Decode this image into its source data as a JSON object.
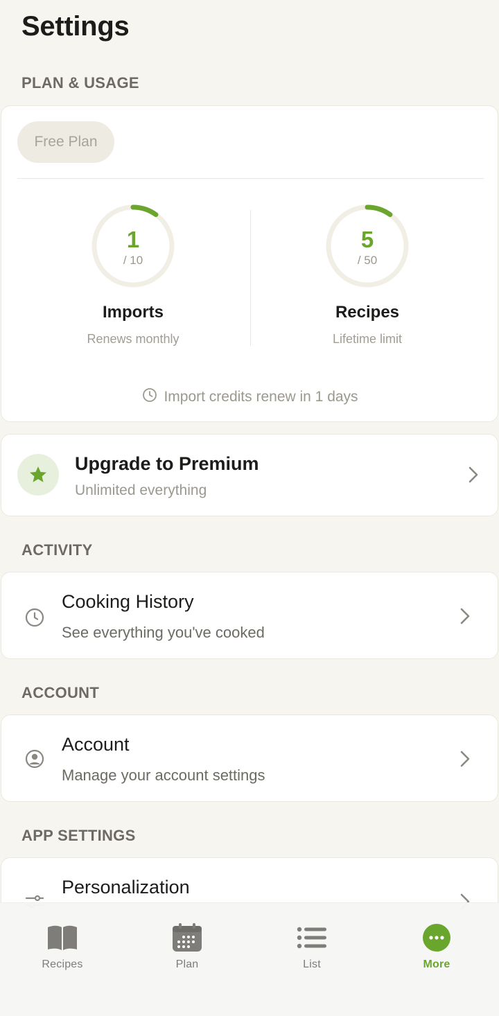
{
  "page": {
    "title": "Settings"
  },
  "sections": {
    "plan_usage": "PLAN & USAGE",
    "activity": "ACTIVITY",
    "account": "ACCOUNT",
    "app_settings": "APP SETTINGS"
  },
  "plan": {
    "chip": "Free Plan",
    "imports": {
      "value": "1",
      "limit": "/ 10",
      "label": "Imports",
      "sub": "Renews monthly",
      "used": 1,
      "max": 10
    },
    "recipes": {
      "value": "5",
      "limit": "/ 50",
      "label": "Recipes",
      "sub": "Lifetime limit",
      "used": 5,
      "max": 50
    },
    "renew_text": "Import credits renew in 1 days"
  },
  "upgrade": {
    "title": "Upgrade to Premium",
    "sub": "Unlimited everything"
  },
  "activity": {
    "title": "Cooking History",
    "sub": "See everything you've cooked"
  },
  "account": {
    "title": "Account",
    "sub": "Manage your account settings"
  },
  "app_settings": {
    "title": "Personalization"
  },
  "tabs": [
    {
      "label": "Recipes",
      "icon": "book-icon"
    },
    {
      "label": "Plan",
      "icon": "calendar-icon"
    },
    {
      "label": "List",
      "icon": "list-icon"
    },
    {
      "label": "More",
      "icon": "more-icon",
      "active": true
    }
  ],
  "colors": {
    "accent": "#6aa52e",
    "background": "#f7f5f0",
    "ring_track": "#f1eee5"
  }
}
